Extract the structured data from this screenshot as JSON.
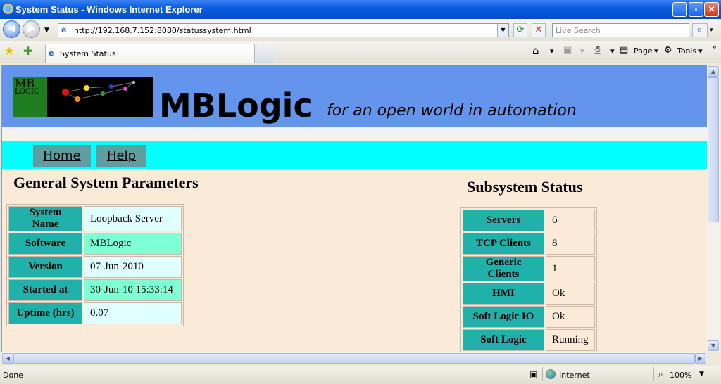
{
  "window": {
    "title": "System Status - Windows Internet Explorer",
    "minimize": "_",
    "maximize": "▫",
    "close": "✕"
  },
  "navbar": {
    "back": "◀",
    "forward": "▶",
    "address": "http://192.168.7.152:8080/statussystem.html",
    "search_placeholder": "Live Search"
  },
  "tabs": {
    "active_tab": "System Status"
  },
  "toolbar": {
    "page": "Page",
    "tools": "Tools"
  },
  "page": {
    "logo_text": "MB\nLOGIC",
    "brand": "MBLogic",
    "slogan": "for an open world in automation",
    "menu": [
      {
        "label": "Home"
      },
      {
        "label": "Help"
      }
    ],
    "general_title": "General System Parameters",
    "general_rows": [
      {
        "key": "System Name",
        "value": "Loopback Server",
        "color": "#e0ffff"
      },
      {
        "key": "Software",
        "value": "MBLogic",
        "color": "#7fffd4"
      },
      {
        "key": "Version",
        "value": "07-Jun-2010",
        "color": "#e0ffff"
      },
      {
        "key": "Started at",
        "value": "30-Jun-10 15:33:14",
        "color": "#7fffd4"
      },
      {
        "key": "Uptime (hrs)",
        "value": "0.07",
        "color": "#e0ffff"
      }
    ],
    "subsystem_title": "Subsystem Status",
    "subsystem_rows": [
      {
        "key": "Servers",
        "value": "6"
      },
      {
        "key": "TCP Clients",
        "value": "8"
      },
      {
        "key": "Generic Clients",
        "value": "1"
      },
      {
        "key": "HMI",
        "value": "Ok"
      },
      {
        "key": "Soft Logic IO",
        "value": "Ok"
      },
      {
        "key": "Soft Logic",
        "value": "Running"
      }
    ]
  },
  "statusbar": {
    "status": "Done",
    "zone": "Internet",
    "zoom": "100%"
  }
}
